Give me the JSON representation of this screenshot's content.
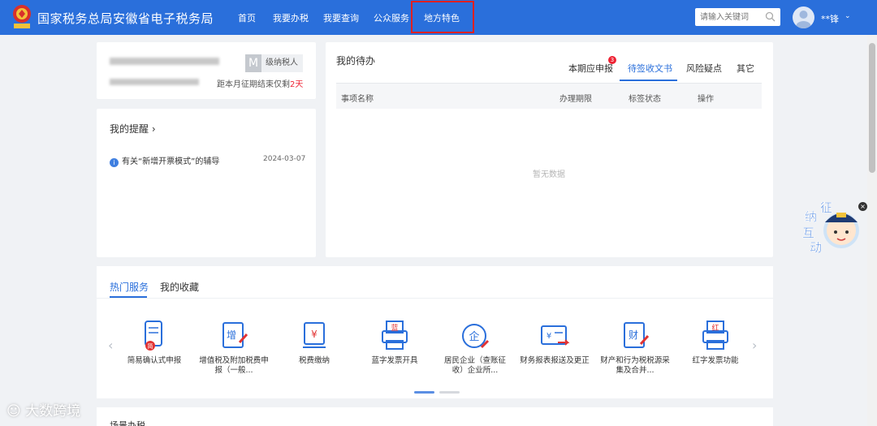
{
  "header": {
    "site_title": "国家税务总局安徽省电子税务局",
    "nav": [
      "首页",
      "我要办税",
      "我要查询",
      "公众服务",
      "地方特色"
    ],
    "search_placeholder": "请输入关键词",
    "user_name": "**锋",
    "user_caret": "⌄",
    "emblem_text": "税务"
  },
  "taxpayer": {
    "level_badge": "M",
    "level_label": "级纳税人",
    "deadline_prefix": "距本月征期结束仅剩",
    "deadline_days": "2天"
  },
  "reminders": {
    "title": "我的提醒 ›",
    "info_icon": "i",
    "items": [
      {
        "text": "有关“新增开票模式”的辅导",
        "date": "2024-03-07"
      }
    ]
  },
  "todo": {
    "title": "我的待办",
    "tabs": [
      "本期应申报",
      "待签收文书",
      "风险疑点",
      "其它"
    ],
    "active_tab": 1,
    "tab_count": "3",
    "columns": [
      "事项名称",
      "办理期限",
      "标签状态",
      "操作"
    ],
    "empty_text": "暂无数据"
  },
  "services": {
    "tabs": [
      "热门服务",
      "我的收藏"
    ],
    "items": [
      {
        "label": "简易确认式申报",
        "icon": "scroll-icon",
        "glyph": "简"
      },
      {
        "label": "增值税及附加税费申报（一般...",
        "icon": "vat-declare-icon",
        "glyph": "增"
      },
      {
        "label": "税费缴纳",
        "icon": "tax-payment-icon",
        "glyph": "¥"
      },
      {
        "label": "蓝字发票开具",
        "icon": "blue-invoice-icon",
        "glyph": "蓝"
      },
      {
        "label": "居民企业（查账征收）企业所...",
        "icon": "enterprise-tax-icon",
        "glyph": "企"
      },
      {
        "label": "财务报表报送及更正",
        "icon": "financial-report-icon",
        "glyph": "¥"
      },
      {
        "label": "财产和行为税税源采集及合并...",
        "icon": "property-tax-icon",
        "glyph": "财"
      },
      {
        "label": "红字发票功能",
        "icon": "red-invoice-icon",
        "glyph": "红"
      }
    ],
    "prev_arrow": "‹",
    "next_arrow": "›"
  },
  "bottom": {
    "title": "场景办税"
  },
  "mascot": {
    "text": [
      "征",
      "纳",
      "互",
      "动"
    ],
    "close": "×"
  },
  "watermark": "大数跨境",
  "colors": {
    "primary": "#2a6fdb",
    "alert": "#e23333",
    "highlight_box": "#e02020"
  }
}
